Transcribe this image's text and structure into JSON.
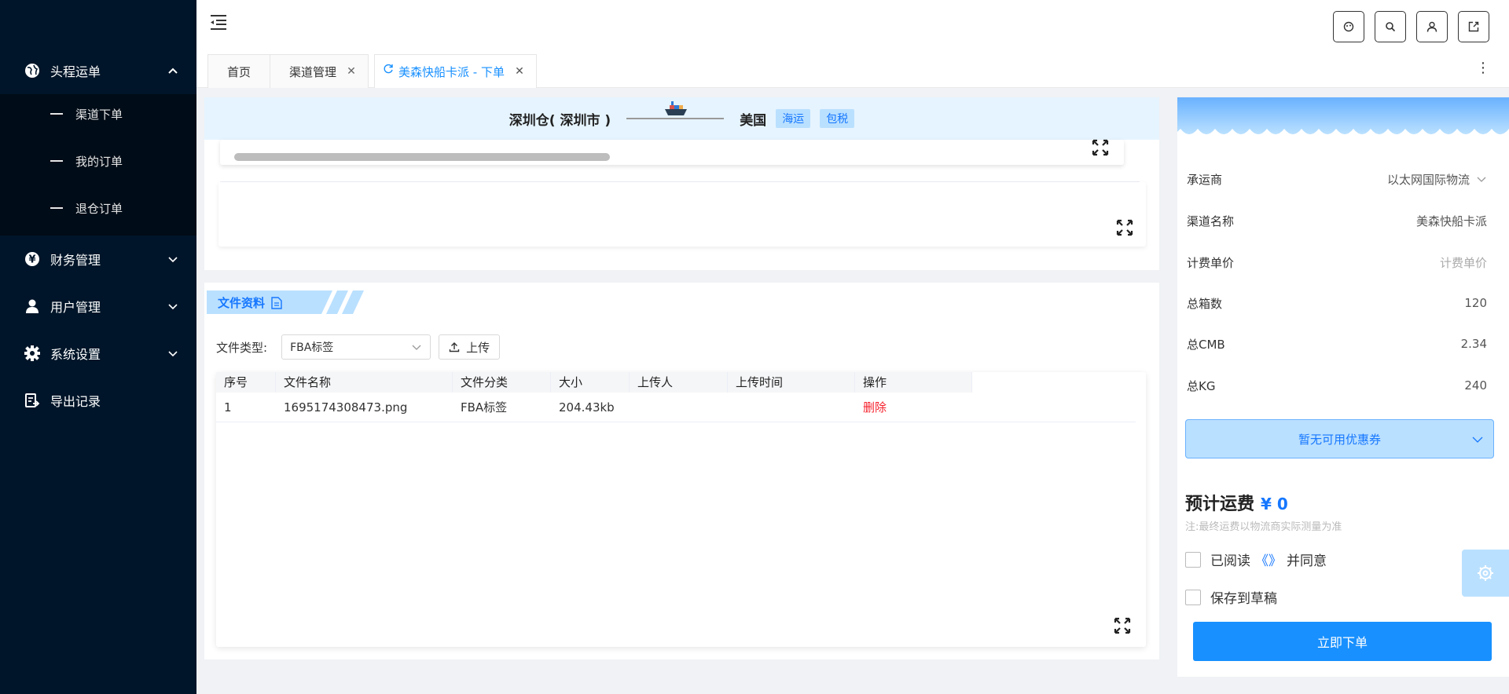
{
  "sidebar": {
    "items": [
      {
        "label": "头程运单",
        "icon": "globe-icon"
      },
      {
        "label": "财务管理",
        "icon": "yen-icon"
      },
      {
        "label": "用户管理",
        "icon": "user-icon"
      },
      {
        "label": "系统设置",
        "icon": "gear-icon"
      },
      {
        "label": "导出记录",
        "icon": "export-doc-icon"
      }
    ],
    "subitems": [
      {
        "label": "渠道下单"
      },
      {
        "label": "我的订单"
      },
      {
        "label": "退仓订单"
      }
    ]
  },
  "tabs": [
    {
      "label": "首页"
    },
    {
      "label": "渠道管理"
    },
    {
      "label": "美森快船卡派 - 下单"
    }
  ],
  "route": {
    "from": "深圳仓( 深圳市 )",
    "to": "美国",
    "tags": [
      "海运",
      "包税"
    ]
  },
  "documents": {
    "section_title": "文件资料",
    "file_type_label": "文件类型:",
    "file_type_value": "FBA标签",
    "upload_label": "上传",
    "columns": [
      "序号",
      "文件名称",
      "文件分类",
      "大小",
      "上传人",
      "上传时间",
      "操作"
    ],
    "rows": [
      {
        "index": "1",
        "name": "1695174308473.png",
        "category": "FBA标签",
        "size": "204.43kb",
        "uploader": "",
        "time": "",
        "action": "删除"
      }
    ]
  },
  "summary": {
    "carrier_label": "承运商",
    "carrier_value": "以太网国际物流",
    "channel_label": "渠道名称",
    "channel_value": "美森快船卡派",
    "unit_label": "计费单价",
    "unit_placeholder": "计费单价",
    "boxes_label": "总箱数",
    "boxes_value": "120",
    "cmb_label": "总CMB",
    "cmb_value": "2.34",
    "kg_label": "总KG",
    "kg_value": "240",
    "coupon": "暂无可用优惠券",
    "fee_label": "预计运费",
    "fee_value": "¥ 0",
    "fee_note": "注:最终运费以物流商实际测量为准",
    "agree_prefix": "已阅读",
    "agree_link": "《》",
    "agree_suffix": "并同意",
    "draft": "保存到草稿",
    "submit": "立即下单"
  },
  "colors": {
    "sidebar": "#001529",
    "primary": "#1890ff",
    "danger": "#f5222d",
    "light_blue": "#bae0ff"
  }
}
